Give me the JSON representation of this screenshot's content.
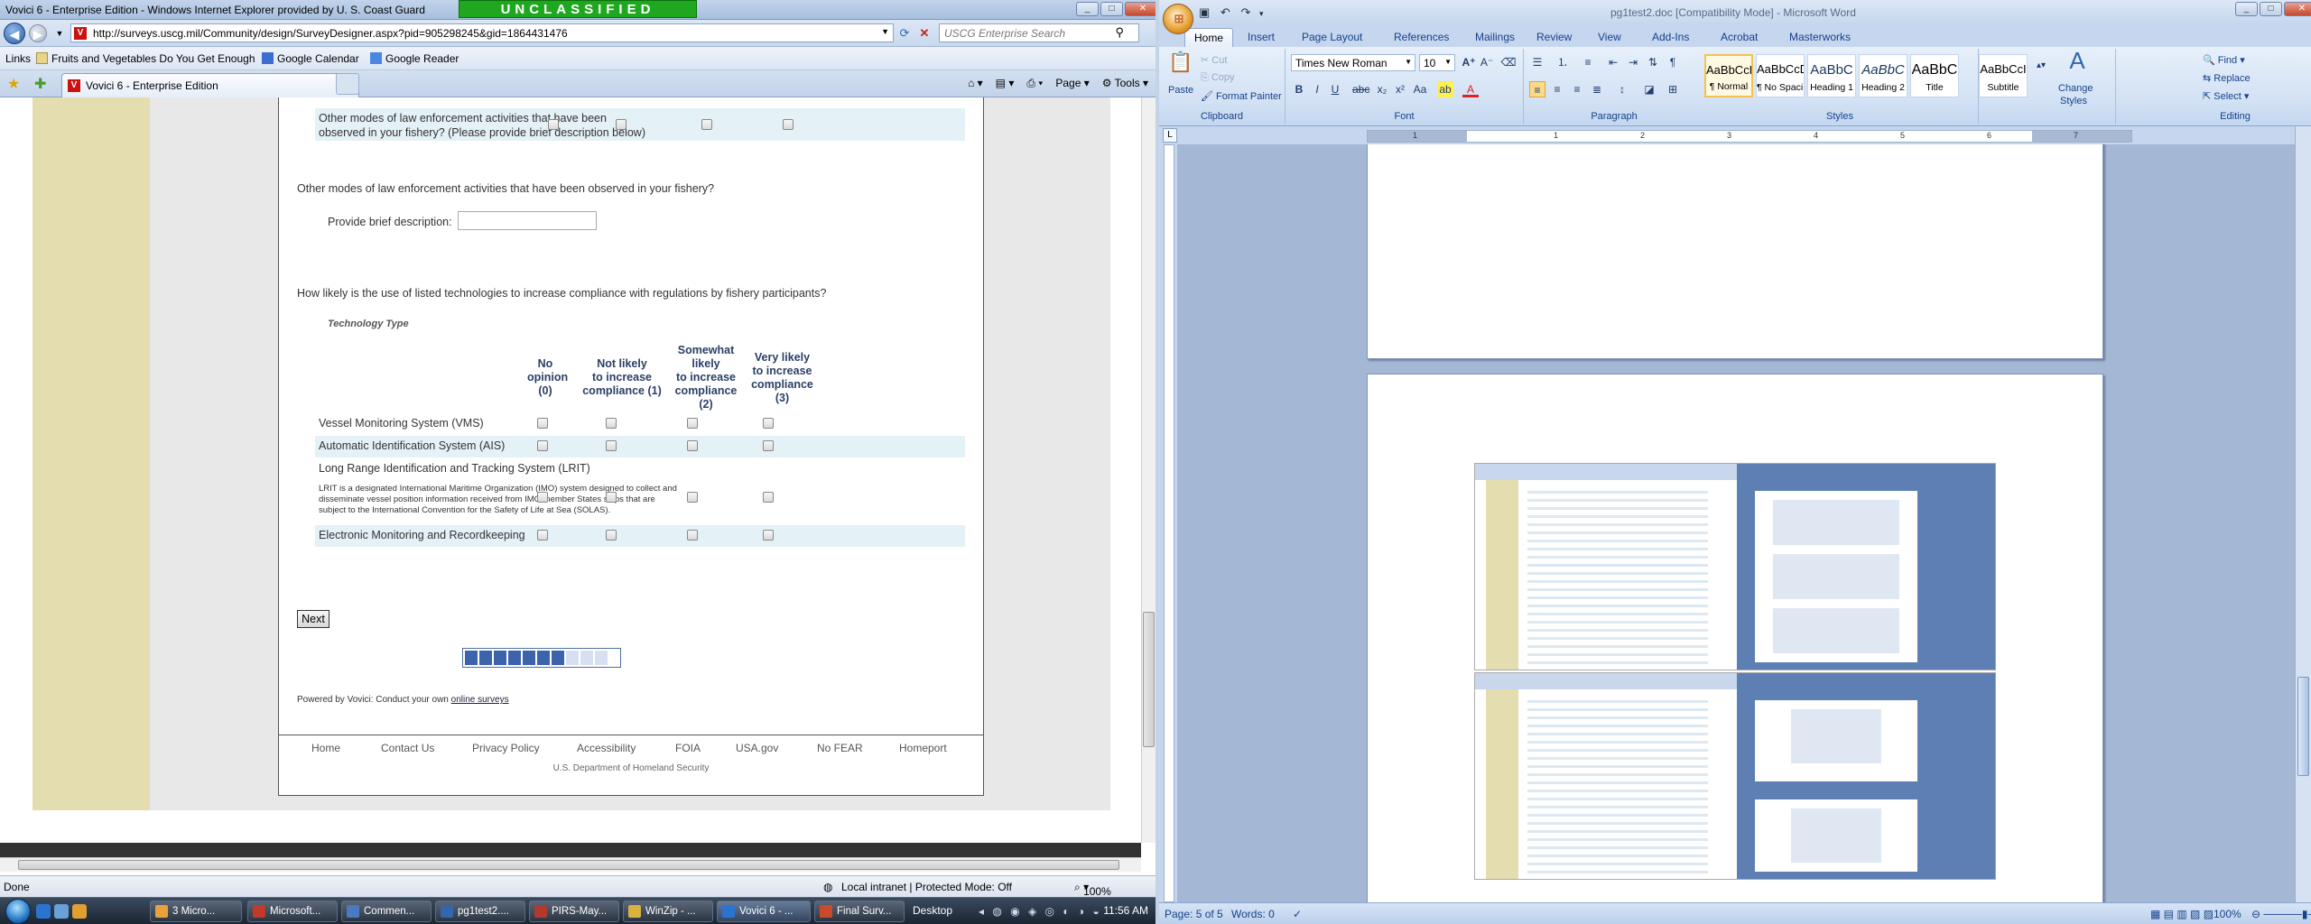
{
  "ie": {
    "title": "Vovici 6 - Enterprise Edition - Windows Internet Explorer provided by U. S. Coast Guard",
    "banner": "UNCLASSIFIED",
    "url": "http://surveys.uscg.mil/Community/design/SurveyDesigner.aspx?pid=905298245&gid=1864431476",
    "search_placeholder": "USCG Enterprise Search",
    "links_label": "Links",
    "links": [
      "Fruits and Vegetables Do You Get Enough",
      "Google Calendar",
      "Google Reader"
    ],
    "tab_label": "Vovici 6 - Enterprise Edition",
    "cmd": {
      "page": "Page",
      "tools": "Tools"
    },
    "status": {
      "left": "Done",
      "zone": "Local intranet | Protected Mode: Off",
      "zoom": "100%"
    }
  },
  "survey": {
    "top_row": {
      "label_line1": "Other modes of law enforcement activities that have been",
      "label_line2": "observed in your fishery? (Please provide brief description below)"
    },
    "q1": {
      "text": "Other modes of law enforcement activities that have been observed in your fishery?",
      "field_label": "Provide brief description:",
      "field_value": ""
    },
    "q2": {
      "text": "How likely is the use of listed technologies to increase compliance with regulations by fishery participants?",
      "tech_header": "Technology Type",
      "columns": [
        [
          "No",
          "opinion",
          "(0)"
        ],
        [
          "Not likely",
          "to increase",
          "compliance (1)"
        ],
        [
          "Somewhat",
          "likely",
          "to increase",
          "compliance",
          "(2)"
        ],
        [
          "Very likely",
          "to increase",
          "compliance",
          "(3)"
        ]
      ],
      "rows": [
        {
          "label": "Vessel Monitoring System (VMS)"
        },
        {
          "label": "Automatic Identification System (AIS)"
        },
        {
          "label": "Long Range Identification and Tracking System (LRIT)"
        },
        {
          "label": "LRIT is a designated International Maritime Organization (IMO) system designed to collect and disseminate vessel position information received from IMO member States ships that are subject to the International Convention for the Safety of Life at Sea (SOLAS)."
        },
        {
          "label": "Electronic Monitoring and Recordkeeping"
        }
      ]
    },
    "next_label": "Next",
    "progress": {
      "filled": 7,
      "total": 10
    },
    "powered_text": "Powered by Vovici: Conduct your own",
    "powered_link": "online surveys",
    "footer_links": [
      "Home",
      "Contact Us",
      "Privacy Policy",
      "Accessibility",
      "FOIA",
      "USA.gov",
      "No FEAR",
      "Homeport"
    ],
    "footer_org": "U.S. Department of Homeland Security"
  },
  "word": {
    "title": "pg1test2.doc [Compatibility Mode] - Microsoft Word",
    "tabs": [
      "Home",
      "Insert",
      "Page Layout",
      "References",
      "Mailings",
      "Review",
      "View",
      "Add-Ins",
      "Acrobat",
      "Masterworks"
    ],
    "clipboard": {
      "paste": "Paste",
      "cut": "Cut",
      "copy": "Copy",
      "format_painter": "Format Painter",
      "label": "Clipboard"
    },
    "font": {
      "name": "Times New Roman",
      "size": "10",
      "label": "Font"
    },
    "paragraph_label": "Paragraph",
    "styles": [
      {
        "sample": "AaBbCcDc",
        "name": "¶ Normal"
      },
      {
        "sample": "AaBbCcDc",
        "name": "¶ No Spaci..."
      },
      {
        "sample": "AaBbC",
        "name": "Heading 1"
      },
      {
        "sample": "AaBbC",
        "name": "Heading 2"
      },
      {
        "sample": "AaBbC",
        "name": "Title"
      },
      {
        "sample": "AaBbCcI",
        "name": "Subtitle"
      }
    ],
    "change_styles_1": "Change",
    "change_styles_2": "Styles",
    "styles_label": "Styles",
    "editing": {
      "find": "Find",
      "replace": "Replace",
      "select": "Select",
      "label": "Editing"
    },
    "ruler_nums": [
      "1",
      "1",
      "2",
      "3",
      "4",
      "5",
      "6",
      "7"
    ],
    "status": {
      "page": "Page: 5 of 5",
      "words": "Words: 0",
      "zoom": "100%"
    }
  },
  "taskbar": {
    "items": [
      "3 Micro...",
      "Microsoft...",
      "Commen...",
      "pg1test2....",
      "PIRS-May...",
      "WinZip - ...",
      "Vovici 6 - ...",
      "Final Surv..."
    ],
    "desktop": "Desktop",
    "clock": "11:56 AM"
  }
}
